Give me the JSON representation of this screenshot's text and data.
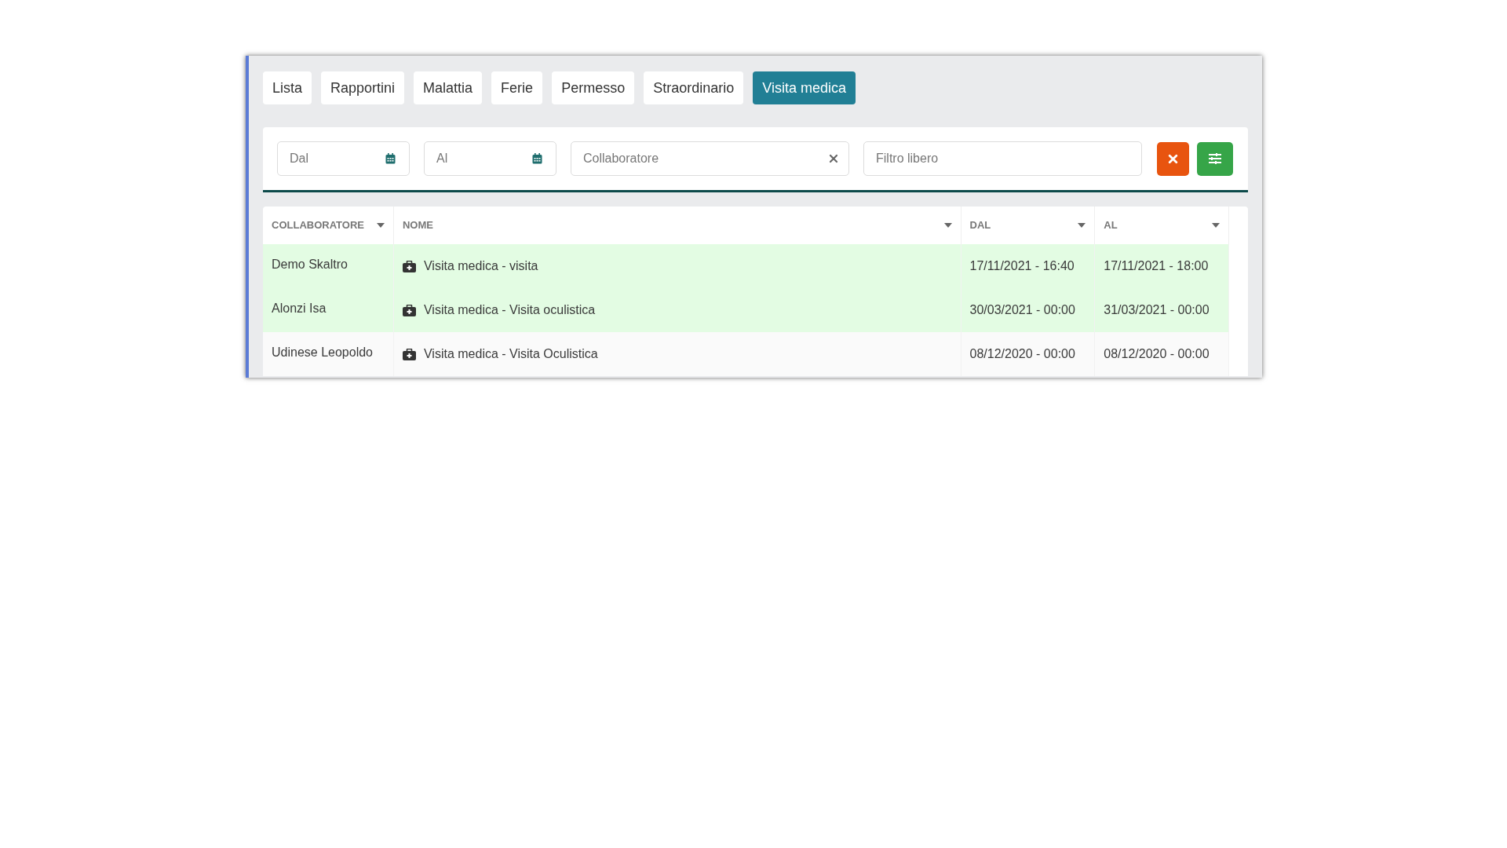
{
  "tabs": [
    {
      "label": "Lista",
      "selected": false
    },
    {
      "label": "Rapportini",
      "selected": false
    },
    {
      "label": "Malattia",
      "selected": false
    },
    {
      "label": "Ferie",
      "selected": false
    },
    {
      "label": "Permesso",
      "selected": false
    },
    {
      "label": "Straordinario",
      "selected": false
    },
    {
      "label": "Visita medica",
      "selected": true
    }
  ],
  "filters": [
    {
      "kind": "date",
      "placeholder": "Dal"
    },
    {
      "kind": "date",
      "placeholder": "Al"
    },
    {
      "kind": "clearable",
      "placeholder": "Collaboratore"
    },
    {
      "kind": "text",
      "placeholder": "Filtro libero"
    }
  ],
  "table": {
    "columns": [
      "COLLABORATORE",
      "NOME",
      "DAL",
      "AL"
    ],
    "rows": [
      {
        "highlighted": true,
        "cells": [
          "Demo Skaltro",
          "Visita medica - visita",
          "17/11/2021 - 16:40",
          "17/11/2021 - 18:00"
        ]
      },
      {
        "highlighted": true,
        "cells": [
          "Alonzi Isa",
          "Visita medica - Visita oculistica",
          "30/03/2021 - 00:00",
          "31/03/2021 - 00:00"
        ]
      },
      {
        "highlighted": false,
        "cells": [
          "Udinese Leopoldo",
          "Visita medica - Visita Oculistica",
          "08/12/2020 - 00:00",
          "08/12/2020 - 00:00"
        ]
      }
    ]
  }
}
